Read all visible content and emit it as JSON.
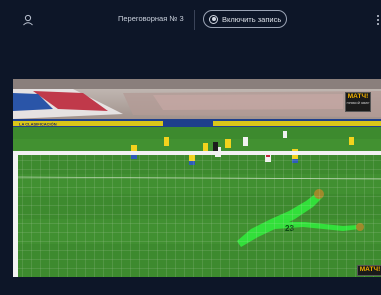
{
  "topbar": {
    "room_title": "Переговорная № 3",
    "record_label": "Включить запись",
    "icons": [
      "user-icon",
      "record-icon",
      "more-icon"
    ]
  },
  "video": {
    "channel_logo": "МАТЧ!",
    "channel_subtitle": "ПРЯМОЙ ЭФИР",
    "channel_logo_bottom": "МАТЧ!",
    "ad_board_text": "LA CLASIFICACIÓN",
    "player_number": "23"
  },
  "colors": {
    "background": "#0d1628",
    "pitch": "#3d8a2e",
    "keeper_kit": "#32e03a",
    "yellow_kit": "#f3d31d"
  }
}
